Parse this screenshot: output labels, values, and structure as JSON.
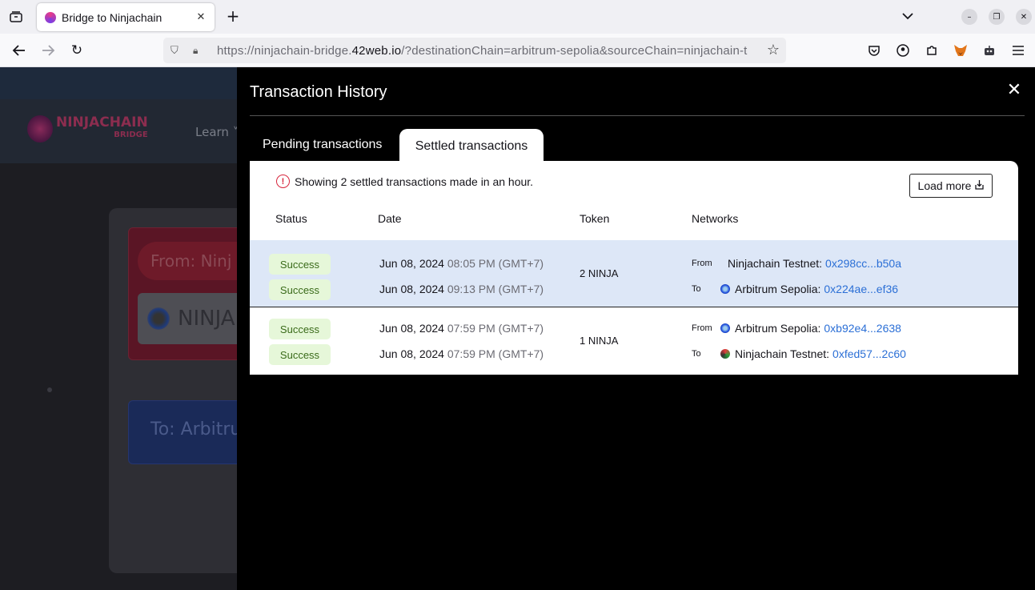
{
  "browser": {
    "tab_title": "Bridge to Ninjachain",
    "url_prefix": "https://ninjachain-bridge.",
    "url_host": "42web.io",
    "url_suffix": "/?destinationChain=arbitrum-sepolia&sourceChain=ninjachain-t"
  },
  "background_page": {
    "logo_text": "NINJACHAIN",
    "logo_sub": "BRIDGE",
    "nav_learn": "Learn",
    "from_label": "From: Ninj",
    "token_label": "NINJA",
    "to_label": "To: Arbitru"
  },
  "modal": {
    "title": "Transaction History",
    "tabs": {
      "pending": "Pending transactions",
      "settled": "Settled transactions"
    },
    "notice": "Showing 2 settled transactions made in an hour.",
    "load_more": "Load more",
    "columns": {
      "status": "Status",
      "date": "Date",
      "token": "Token",
      "networks": "Networks"
    },
    "rows": [
      {
        "status_from": "Success",
        "status_to": "Success",
        "date_from_day": "Jun 08, 2024",
        "date_from_time": "08:05 PM (GMT+7)",
        "date_to_day": "Jun 08, 2024",
        "date_to_time": "09:13 PM (GMT+7)",
        "token": "2 NINJA",
        "from_label": "From",
        "from_chain": "Ninjachain Testnet:",
        "from_addr": "0x298cc...b50a",
        "to_label": "To",
        "to_chain": "Arbitrum Sepolia:",
        "to_addr": "0x224ae...ef36"
      },
      {
        "status_from": "Success",
        "status_to": "Success",
        "date_from_day": "Jun 08, 2024",
        "date_from_time": "07:59 PM (GMT+7)",
        "date_to_day": "Jun 08, 2024",
        "date_to_time": "07:59 PM (GMT+7)",
        "token": "1 NINJA",
        "from_label": "From",
        "from_chain": "Arbitrum Sepolia:",
        "from_addr": "0xb92e4...2638",
        "to_label": "To",
        "to_chain": "Ninjachain Testnet:",
        "to_addr": "0xfed57...2c60"
      }
    ]
  },
  "icons": {
    "selected_row_bg": "#dde7f7",
    "success_bg": "#e6f7d9",
    "link_color": "#2b6fd6",
    "warning_color": "#d7263d"
  }
}
